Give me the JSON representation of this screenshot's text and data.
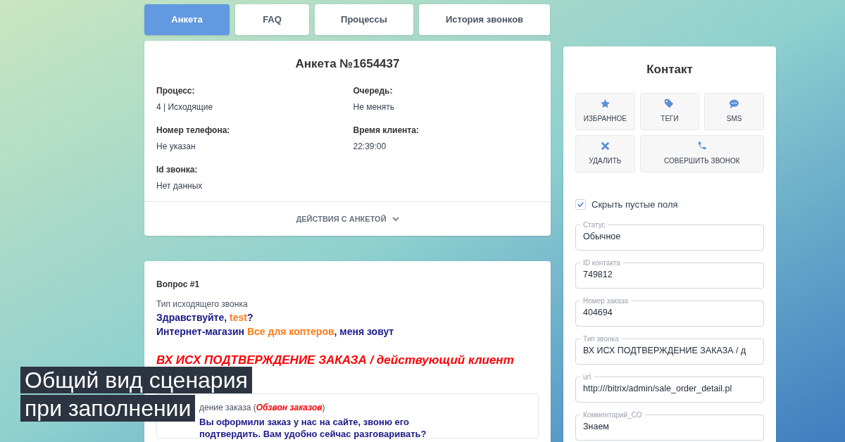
{
  "tabs": [
    {
      "label": "Анкета",
      "selected": true
    },
    {
      "label": "FAQ",
      "selected": false
    },
    {
      "label": "Процессы",
      "selected": false
    },
    {
      "label": "История звонков",
      "selected": false
    }
  ],
  "form_card": {
    "title": "Анкета №1654437",
    "fields": [
      {
        "label": "Процесс:",
        "value": "4 | Исходящие"
      },
      {
        "label": "Очередь:",
        "value": "Не менять"
      },
      {
        "label": "Номер телефона:",
        "value": "Не указан"
      },
      {
        "label": "Время клиента:",
        "value": "22:39:00"
      },
      {
        "label": "Id звонка:",
        "value": "Нет данных"
      }
    ],
    "actions_label": "ДЕЙСТВИЯ С АНКЕТОЙ"
  },
  "question_card": {
    "heading": "Вопрос #1",
    "subtitle": "Тип исходящего звонка",
    "lines": [
      [
        {
          "kind": "script",
          "text": "Здравствуйте, "
        },
        {
          "kind": "variable",
          "text": "test"
        },
        {
          "kind": "script",
          "text": "?"
        }
      ],
      [
        {
          "kind": "script",
          "text": "Интернет-магазин "
        },
        {
          "kind": "variable",
          "text": "Все для коптеров"
        },
        {
          "kind": "script",
          "text": ", меня зовут"
        }
      ]
    ],
    "call_type": "ВХ ИСХ ПОДТВЕРЖДЕНИЕ ЗАКАЗА / действующий клиент",
    "nested": {
      "title_parts": [
        {
          "kind": "plain",
          "text": "дение заказа ("
        },
        {
          "kind": "highlight",
          "text": "Обзвон заказов"
        },
        {
          "kind": "plain",
          "text": ")"
        }
      ],
      "text": "Вы оформили заказ у нас на сайте, звоню его подтвердить. Вам удобно сейчас разговаривать?"
    }
  },
  "contact_panel": {
    "title": "Контакт",
    "actions": [
      {
        "kind": "star",
        "label": "ИЗБРАННОЕ"
      },
      {
        "kind": "tag",
        "label": "ТЕГИ"
      },
      {
        "kind": "chat",
        "label": "SMS"
      },
      {
        "kind": "close",
        "label": "УДАЛИТЬ"
      },
      {
        "kind": "phone",
        "label": "СОВЕРШИТЬ ЗВОНОК"
      }
    ],
    "hide_empty": {
      "label": "Скрыть пустые поля",
      "checked": true
    },
    "fields": [
      {
        "label": "Статус",
        "value": "Обычное"
      },
      {
        "label": "ID контакта",
        "value": "749812"
      },
      {
        "label": "Номер заказа",
        "value": "404694"
      },
      {
        "label": "Тип звонка",
        "value": "ВХ ИСХ ПОДТВЕРЖДЕНИЕ ЗАКАЗА / д"
      },
      {
        "label": "url",
        "value": "http:///bitrix/admin/sale_order_detail.pl"
      },
      {
        "label": "Комментарий_CO",
        "value": "Знаем"
      }
    ]
  },
  "caption": [
    "Общий вид сценария",
    "при заполнении"
  ]
}
